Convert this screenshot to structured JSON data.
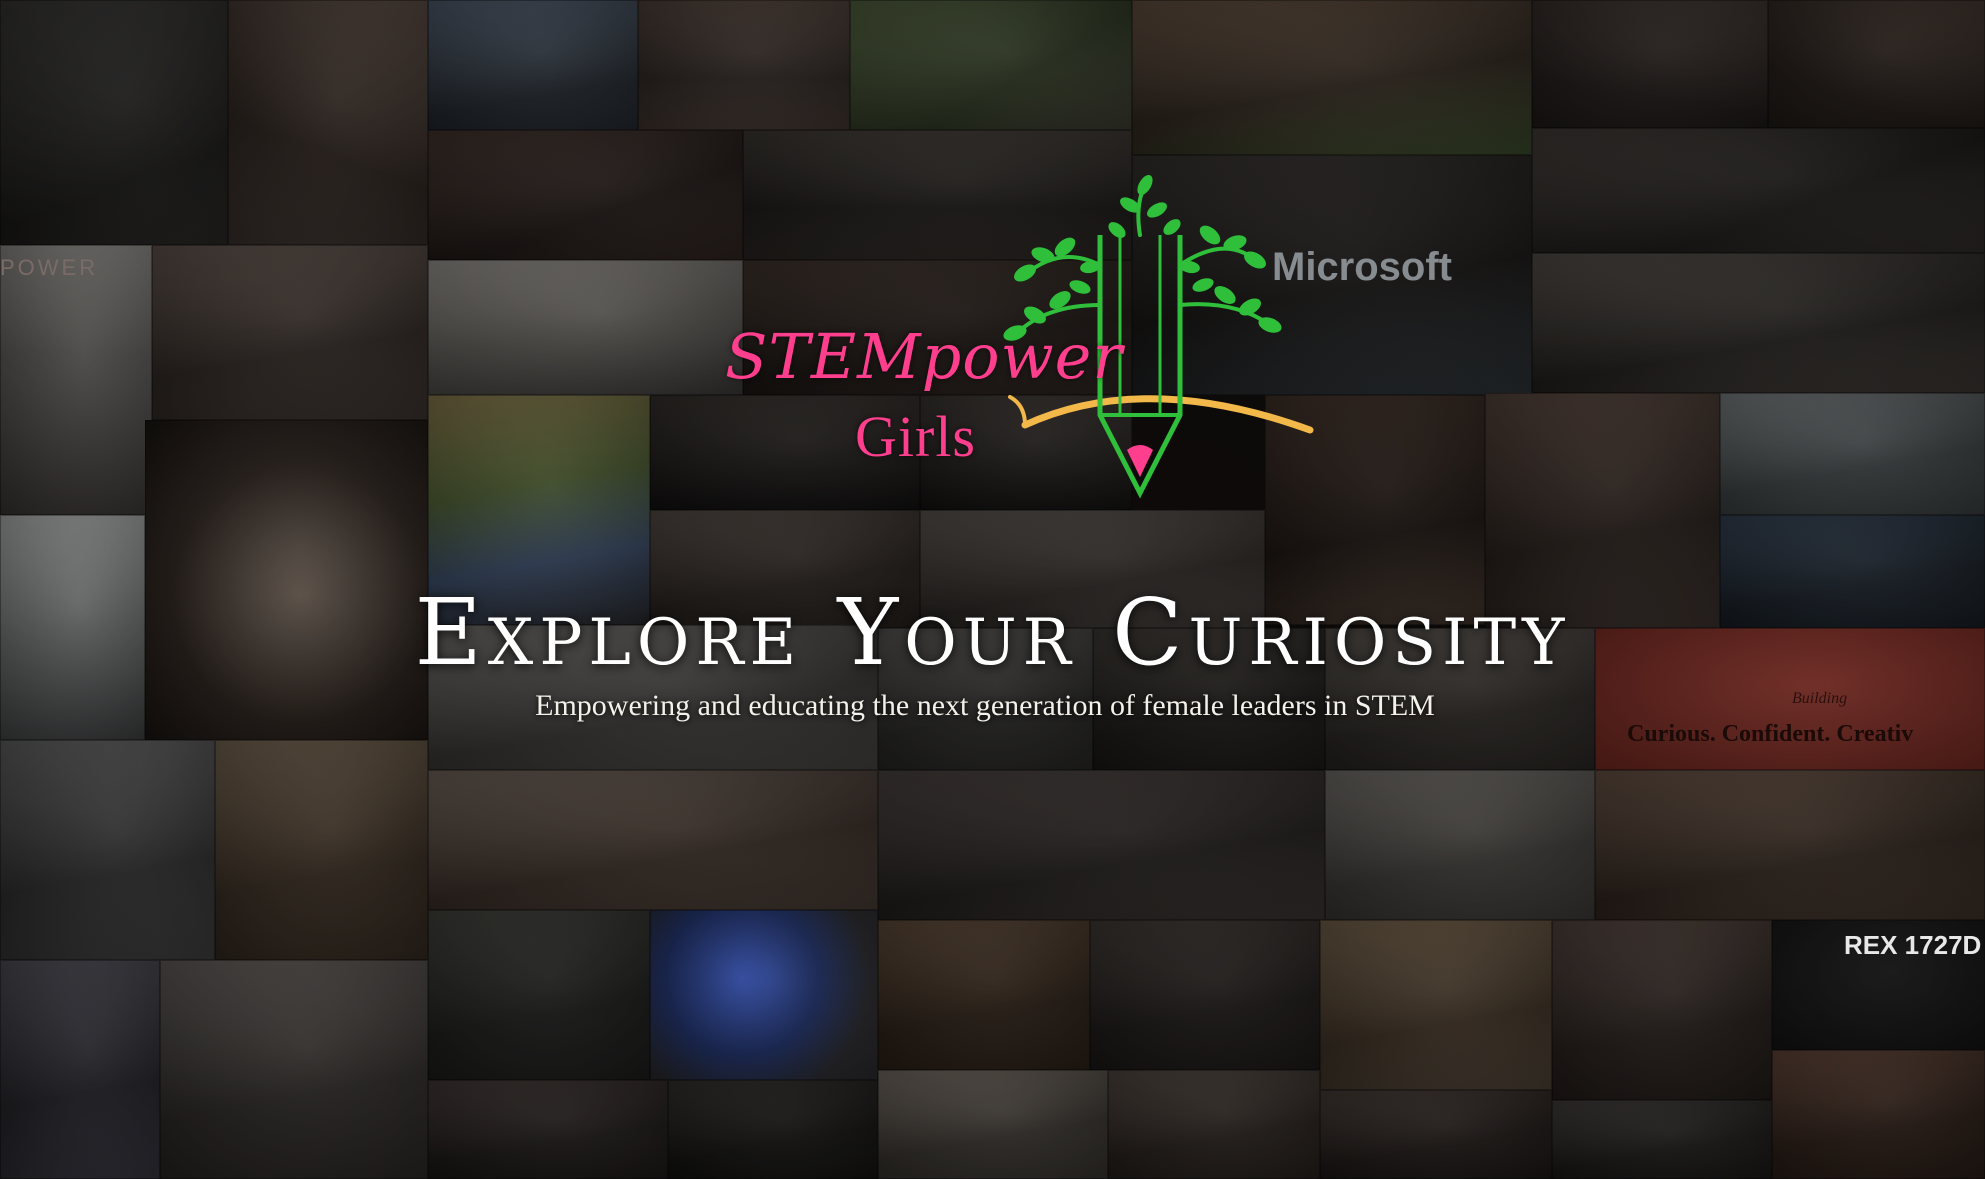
{
  "hero": {
    "logo": {
      "line1": "STEMpower",
      "line2": "Girls",
      "color": "#ff3f8e",
      "tree_color": "#2fbf3a",
      "pencil_tip_color": "#ff3f8e",
      "arc_color": "#f2b84a"
    },
    "headline": "Explore Your Curiosity",
    "subheadline": "Empowering and educating the next generation of female leaders in STEM"
  },
  "collage": {
    "photo_texts": {
      "power_sign": "POWER",
      "microsoft_sign": "Microsoft",
      "sign_building": "Building",
      "sign_curious": "Curious. Confident. Creativ",
      "rex_sign": "REX 1727D"
    },
    "accent_sign_color": "#c9453b"
  }
}
